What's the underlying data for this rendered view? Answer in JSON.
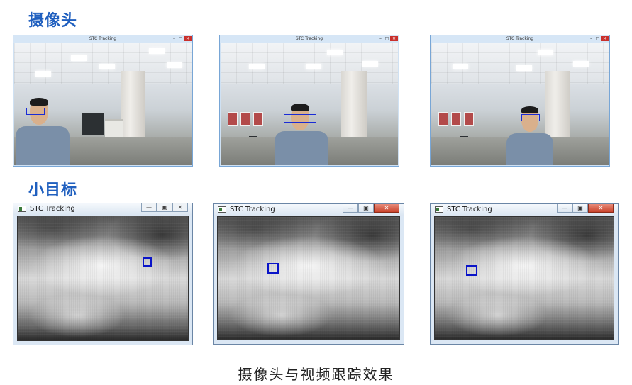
{
  "section_camera": {
    "title": "摄像头"
  },
  "section_small_target": {
    "title": "小目标"
  },
  "caption": "摄像头与视频跟踪效果",
  "colors": {
    "title_blue": "#1f5fbf",
    "track_box": "#1a2bd6"
  },
  "camera_windows": [
    {
      "title": "STC Tracking",
      "min": "–",
      "max": "□",
      "close": "✕"
    },
    {
      "title": "STC Tracking",
      "min": "–",
      "max": "□",
      "close": "✕"
    },
    {
      "title": "STC Tracking",
      "min": "–",
      "max": "□",
      "close": "✕"
    }
  ],
  "tracking_windows": [
    {
      "title": "STC Tracking",
      "min": "—",
      "max": "▣",
      "close": "✕"
    },
    {
      "title": "STC Tracking",
      "min": "—",
      "max": "▣",
      "close": "✕"
    },
    {
      "title": "STC Tracking",
      "min": "—",
      "max": "▣",
      "close": "✕"
    }
  ]
}
